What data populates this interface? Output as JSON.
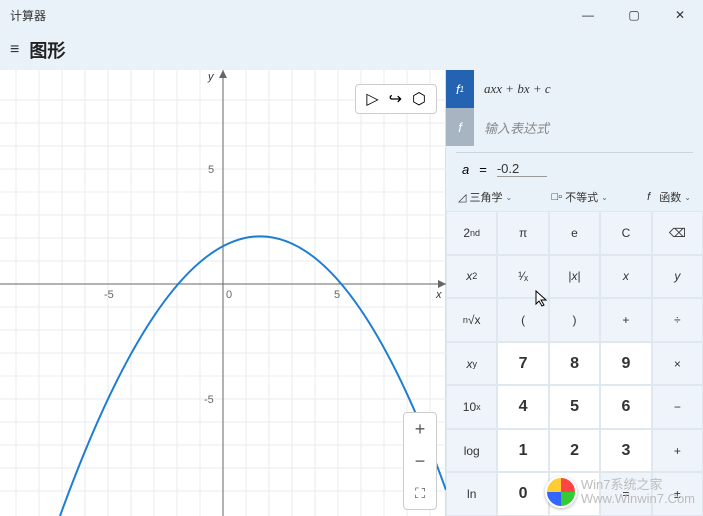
{
  "titlebar": "计算器",
  "header": {
    "title": "图形"
  },
  "axes": {
    "x_label": "x",
    "y_label": "y",
    "ticks_x": [
      "-5",
      "0",
      "5"
    ],
    "tick_y_pos": "5",
    "tick_y_neg": "-5"
  },
  "functions": {
    "f1": {
      "badge": "f",
      "sub": "1",
      "expr": "axx + bx + c"
    },
    "finput": {
      "badge": "f",
      "placeholder": "输入表达式"
    }
  },
  "variable": {
    "name": "a",
    "eq": "=",
    "value": "-0.2"
  },
  "dropdowns": {
    "trig": "三角学",
    "ineq": "不等式",
    "func": "函数",
    "func_prefix": "f"
  },
  "keypad": [
    [
      "2nd",
      "π",
      "e",
      "C",
      "⌫"
    ],
    [
      "x²",
      "¹⁄ₓ",
      "|x|",
      "x",
      "y"
    ],
    [
      "√x",
      "(",
      ")",
      "+",
      "÷"
    ],
    [
      "xʸ",
      "7",
      "8",
      "9",
      "×"
    ],
    [
      "10ˣ",
      "4",
      "5",
      "6",
      "−"
    ],
    [
      "log",
      "1",
      "2",
      "3",
      "+"
    ],
    [
      "ln",
      "0",
      ".",
      "=",
      "±"
    ]
  ],
  "watermark": {
    "line1": "Win7系统之家",
    "line2": "Www.Winwin7.Com"
  }
}
